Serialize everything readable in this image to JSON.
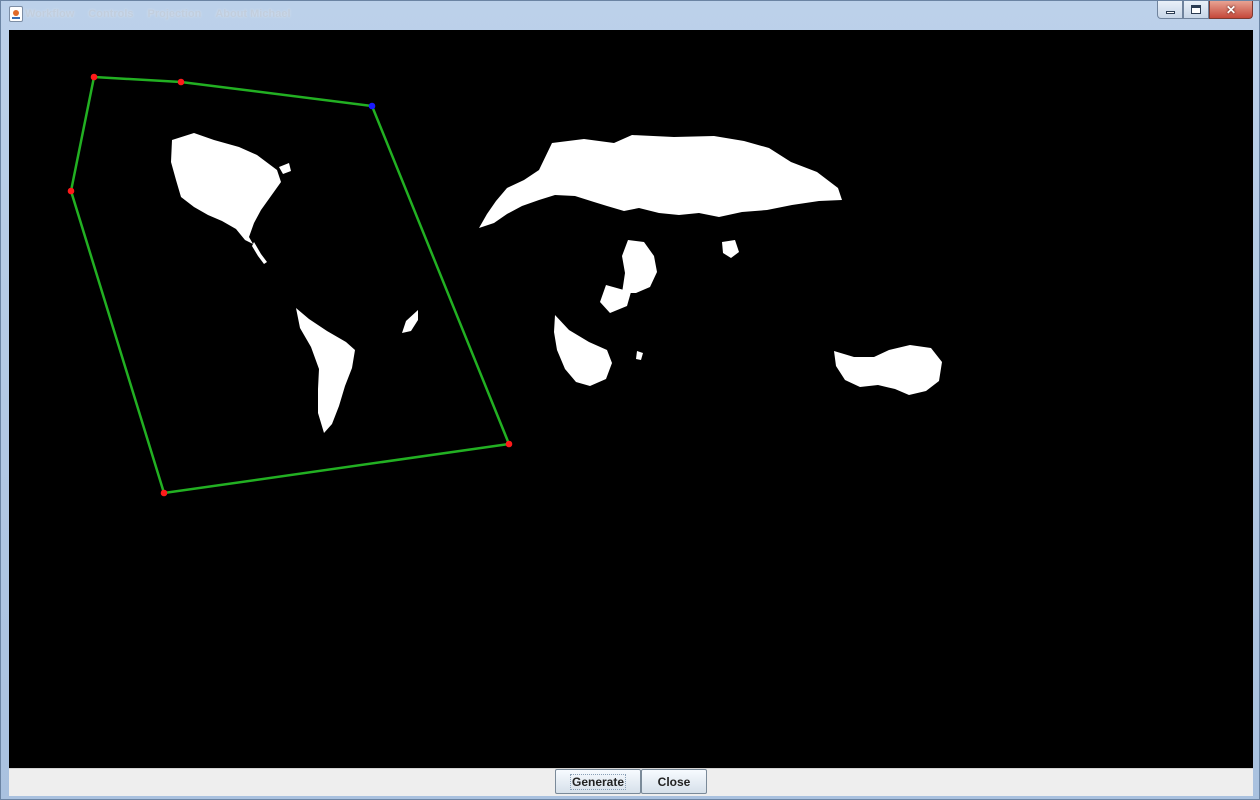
{
  "window": {
    "menu": [
      "Workflow",
      "Controls",
      "Projection",
      "About Michael"
    ],
    "close_glyph": "✕"
  },
  "canvas": {
    "background": "#000000",
    "land_color": "#ffffff",
    "polygon": {
      "stroke": "#22b022"
    },
    "markers": {
      "vertex_color": "#ff1a1a",
      "selected_color": "#1a1aff"
    }
  },
  "buttons": {
    "generate": "Generate",
    "close": "Close"
  }
}
